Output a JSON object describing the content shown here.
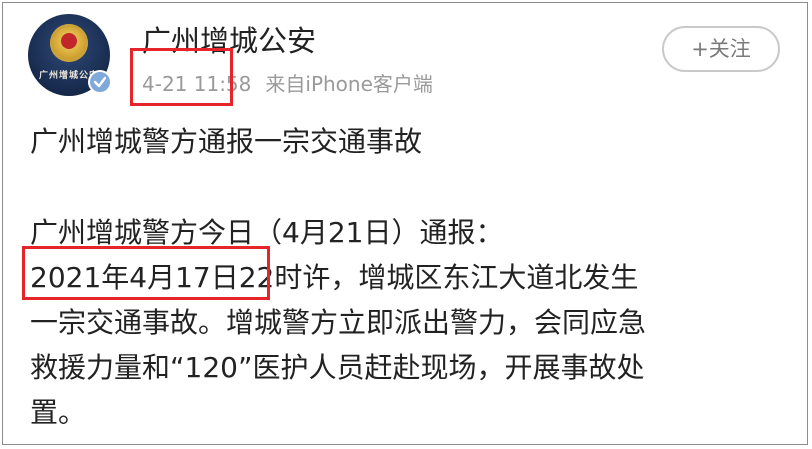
{
  "post": {
    "author_name": "广州增城公安",
    "avatar_ring_text": "广州增城公安",
    "timestamp": "4-21 11:58",
    "source": "来自iPhone客户端",
    "follow_label": "+关注",
    "headline": "广州增城警方通报一宗交通事故",
    "body_lines": [
      "广州增城警方今日（4月21日）通报：",
      "2021年4月17日22时许，增城区东江大道北发生",
      "一宗交通事故。增城警方立即派出警力，会同应急",
      "救援力量和“120”医护人员赶赴现场，开展事故处",
      "置。"
    ]
  },
  "annotations": {
    "highlight_color": "#e5252a"
  },
  "colors": {
    "text": "#222222",
    "meta": "#9a9a9a",
    "verified_badge": "#7fa9db"
  }
}
